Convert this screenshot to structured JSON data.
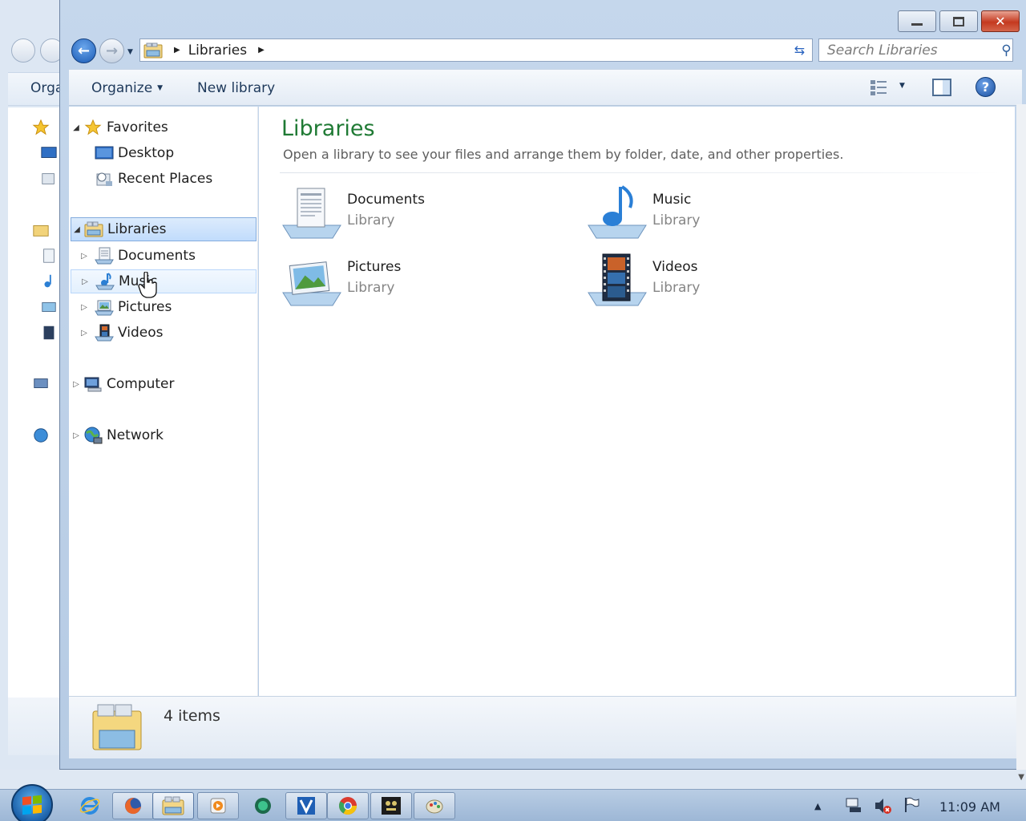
{
  "window": {
    "title": "Libraries",
    "colors": {
      "accent": "#1f7a34",
      "selection": "#c1dcfc",
      "close": "#c4391f"
    }
  },
  "background_window": {
    "organize_label": "Orga"
  },
  "address": {
    "breadcrumb": [
      "Libraries"
    ],
    "search_placeholder": "Search Libraries"
  },
  "toolbar": {
    "organize_label": "Organize",
    "new_library_label": "New library"
  },
  "nav_pane": {
    "favorites": {
      "label": "Favorites",
      "items": [
        {
          "label": "Desktop",
          "icon": "desktop-icon"
        },
        {
          "label": "Recent Places",
          "icon": "recent-places-icon"
        }
      ]
    },
    "libraries": {
      "label": "Libraries",
      "items": [
        {
          "label": "Documents",
          "icon": "documents-icon"
        },
        {
          "label": "Music",
          "icon": "music-icon"
        },
        {
          "label": "Pictures",
          "icon": "pictures-icon"
        },
        {
          "label": "Videos",
          "icon": "videos-icon"
        }
      ]
    },
    "computer": {
      "label": "Computer"
    },
    "network": {
      "label": "Network"
    }
  },
  "content": {
    "title": "Libraries",
    "subtitle": "Open a library to see your files and arrange them by folder, date, and other properties.",
    "libraries": [
      {
        "name": "Documents",
        "type": "Library",
        "icon": "documents-library-icon"
      },
      {
        "name": "Music",
        "type": "Library",
        "icon": "music-library-icon"
      },
      {
        "name": "Pictures",
        "type": "Library",
        "icon": "pictures-library-icon"
      },
      {
        "name": "Videos",
        "type": "Library",
        "icon": "videos-library-icon"
      }
    ]
  },
  "status": {
    "item_count": "4 items"
  },
  "taskbar": {
    "clock": "11:09 AM",
    "apps": [
      "internet-explorer-icon",
      "firefox-icon",
      "file-explorer-icon",
      "media-player-icon",
      "chat-app-icon",
      "visual-studio-icon",
      "chrome-icon",
      "game-app-icon",
      "paint-icon"
    ]
  }
}
